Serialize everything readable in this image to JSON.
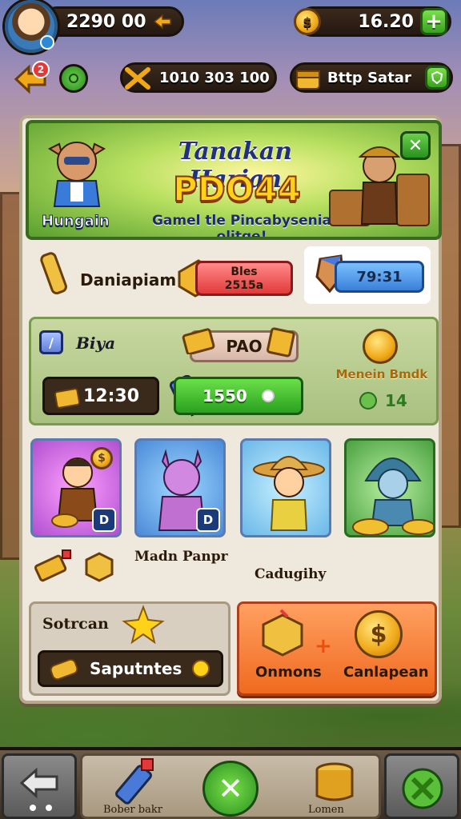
{
  "hud": {
    "player_value": "2290 00",
    "coins_value": "16.20",
    "plus_symbol": "+",
    "resource_a": "1010 303 100",
    "resource_b": "Bttp Satar",
    "notification_count": "2"
  },
  "banner": {
    "title": "Tanakan Harian",
    "code": "PDO44",
    "subtitle": "Gamel tle Pincabysenia olitge!",
    "character_name": "Hungain",
    "close_symbol": "✕"
  },
  "row1": {
    "label": "Daniapiam",
    "red_timer_line1": "Bles",
    "red_timer_line2": "2515a",
    "blue_timer": "79:31"
  },
  "green_panel": {
    "check_mark": "/",
    "label": "Biya",
    "value": "PAO",
    "timer": "12:30",
    "bar_value": "1550",
    "right_label": "Menein Bmdk",
    "right_count": "14"
  },
  "cards": {
    "badge_1": "D",
    "badge_2": "D",
    "caption_1": "Madn Panpr",
    "caption_2": "Cadugihy"
  },
  "sub_left": {
    "title": "Sotrcan",
    "button_label": "Saputntes"
  },
  "sub_right": {
    "label_left": "Onmons",
    "label_right": "Canlapean",
    "plus_symbol": "+"
  },
  "bottom_nav": {
    "label_mid_left": "Bober bakr",
    "label_mid_right": "Lomen",
    "center_symbol": "✕"
  },
  "colors": {
    "accent_green": "#3aa020",
    "coin_gold": "#f0a818",
    "panel_bg": "#efe8dc",
    "banner_title": "#23307a",
    "banner_code": "#ffd21a",
    "timer_red": "#e23a3a",
    "timer_blue": "#3a80d8",
    "orange_panel": "#f06a20"
  }
}
